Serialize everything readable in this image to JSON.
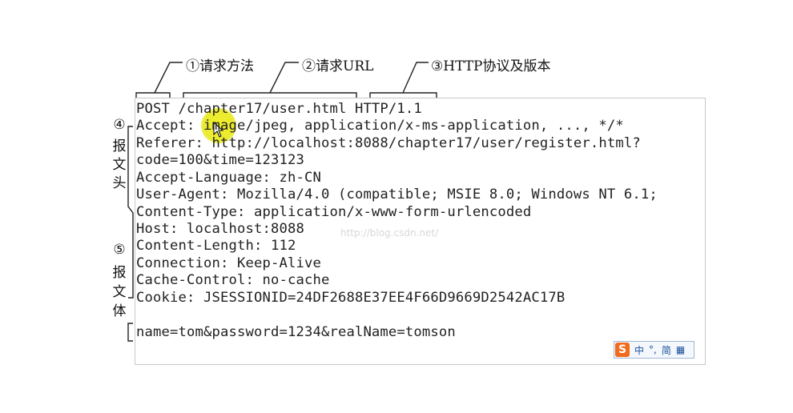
{
  "top_labels": {
    "method": "①请求方法",
    "url": "②请求URL",
    "protocol": "③HTTP协议及版本"
  },
  "side_labels": {
    "header_num": "④",
    "header_chars": [
      "报",
      "文",
      "头"
    ],
    "body_num": "⑤",
    "body_chars": [
      "报",
      "文",
      "体"
    ]
  },
  "request_lines": [
    "POST /chapter17/user.html HTTP/1.1",
    "Accept: image/jpeg, application/x-ms-application, ..., */*",
    "Referer: http://localhost:8088/chapter17/user/register.html?",
    "code=100&time=123123",
    "Accept-Language: zh-CN",
    "User-Agent: Mozilla/4.0 (compatible; MSIE 8.0; Windows NT 6.1;",
    "Content-Type: application/x-www-form-urlencoded",
    "Host: localhost:8088",
    "Content-Length: 112",
    "Connection: Keep-Alive",
    "Cache-Control: no-cache",
    "Cookie: JSESSIONID=24DF2688E37EE4F66D9669D2542AC17B",
    "",
    "name=tom&password=1234&realName=tomson"
  ],
  "watermark": "http://blog.csdn.net/",
  "ime": {
    "logo": "S",
    "lang": "中",
    "punct": "°,",
    "mode": "简",
    "grid": "▦"
  }
}
